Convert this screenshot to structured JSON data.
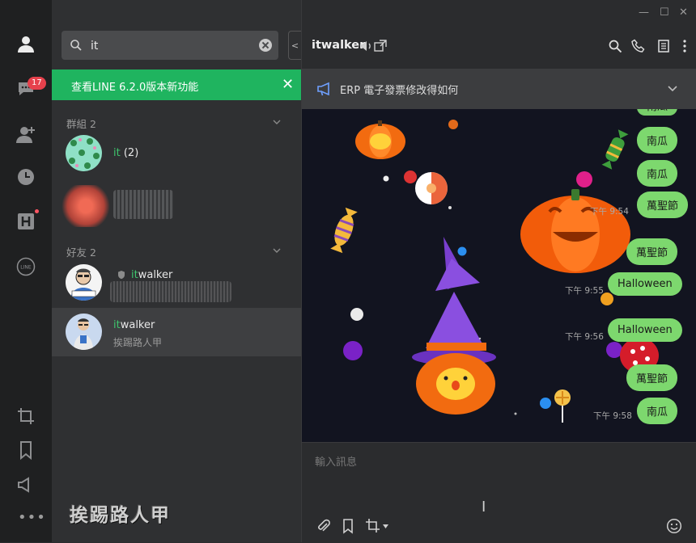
{
  "rail": {
    "unread_count": "17"
  },
  "search": {
    "value": "it"
  },
  "notice": {
    "text": "查看LINE 6.2.0版本新功能"
  },
  "sections": {
    "groups": {
      "label": "群組 2"
    },
    "friends": {
      "label": "好友 2"
    }
  },
  "groups": [
    {
      "name_highlight": "it",
      "name_rest": "",
      "count": "(2)"
    }
  ],
  "friends": [
    {
      "name_highlight": "it",
      "name_rest": "walker",
      "status": ""
    },
    {
      "name_highlight": "it",
      "name_rest": "walker",
      "status": "挨踢路人甲"
    }
  ],
  "chat": {
    "title": "itwalker",
    "pinned_announcement": "ERP 電子發票修改得如何",
    "messages": [
      {
        "text": "南瓜",
        "time": ""
      },
      {
        "text": "南瓜",
        "time": ""
      },
      {
        "text": "南瓜",
        "time": "下午 9:54"
      },
      {
        "text": "萬聖節",
        "time": ""
      },
      {
        "text": "Halloween",
        "time": "下午 9:55"
      },
      {
        "text": "Halloween",
        "time": "下午 9:56"
      },
      {
        "text": "萬聖節",
        "time": ""
      },
      {
        "text": "南瓜",
        "time": "下午 9:58"
      }
    ],
    "composer_placeholder": "輸入訊息"
  },
  "watermark": "挨踢路人甲"
}
